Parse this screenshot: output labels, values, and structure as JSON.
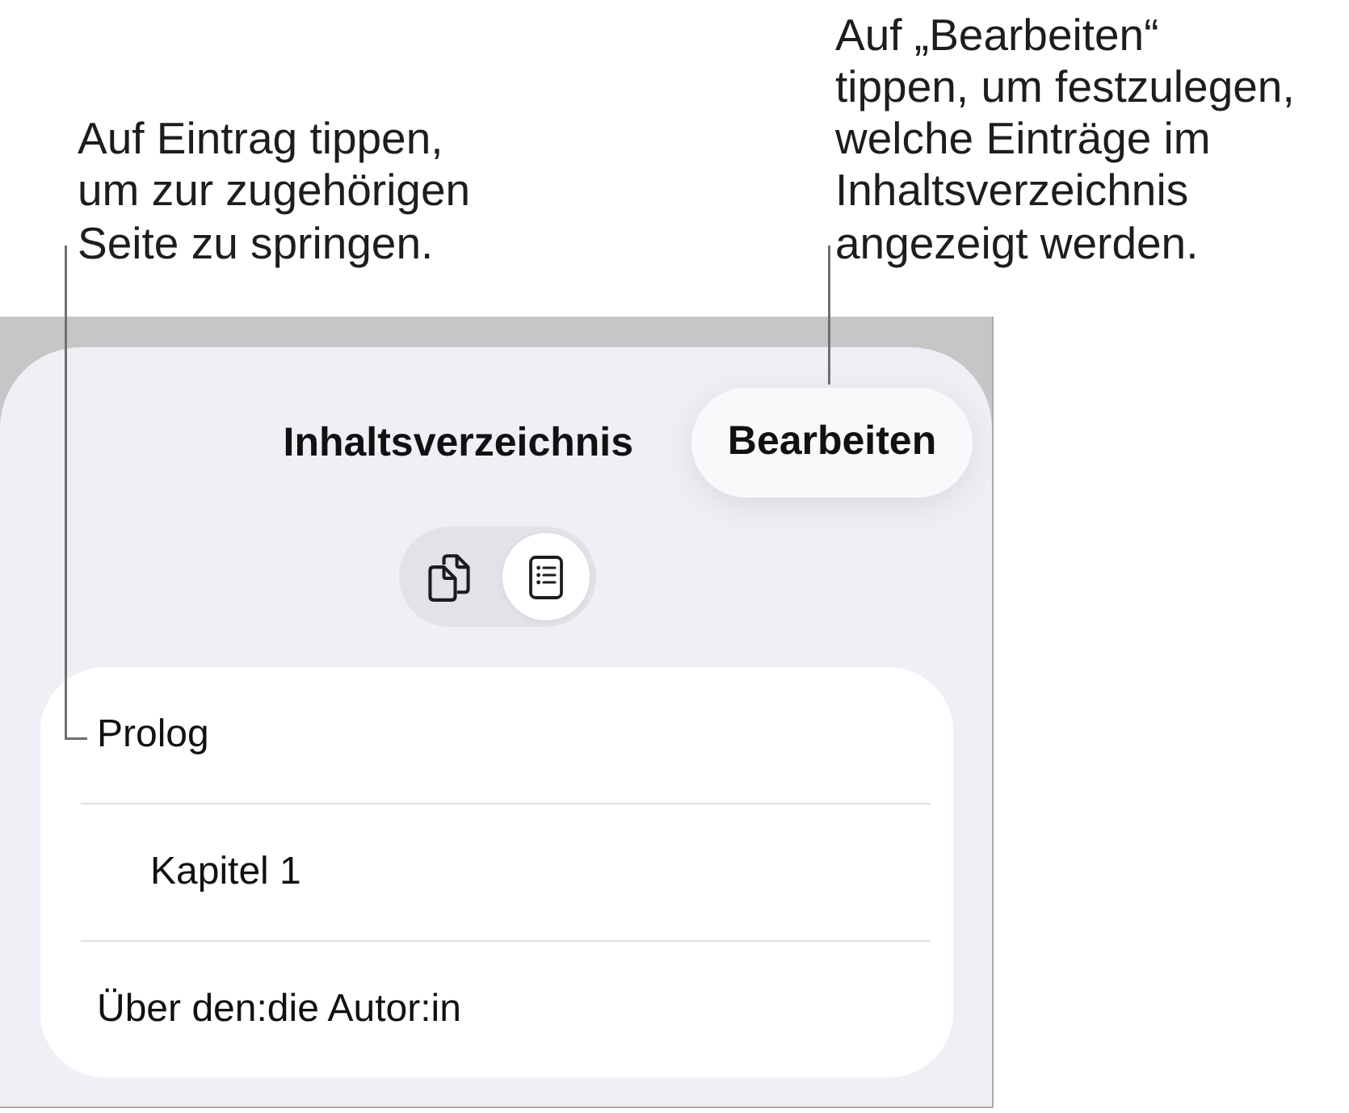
{
  "callouts": [
    {
      "text": "Auf Eintrag tippen,\num zur zugehörigen\nSeite zu springen."
    },
    {
      "text": "Auf „Bearbeiten“\ntippen, um festzulegen,\nwelche Einträge im\nInhaltsverzeichnis\nangezeigt werden."
    }
  ],
  "panel": {
    "title": "Inhaltsverzeichnis",
    "edit_button": "Bearbeiten",
    "view_toggle": [
      {
        "kind": "pages",
        "selected": false
      },
      {
        "kind": "outline",
        "selected": true
      }
    ],
    "entries": [
      {
        "label": "Prolog",
        "children": [
          {
            "label": "Kapitel 1"
          }
        ]
      },
      {
        "label": "Über den:die Autor:in"
      }
    ]
  }
}
